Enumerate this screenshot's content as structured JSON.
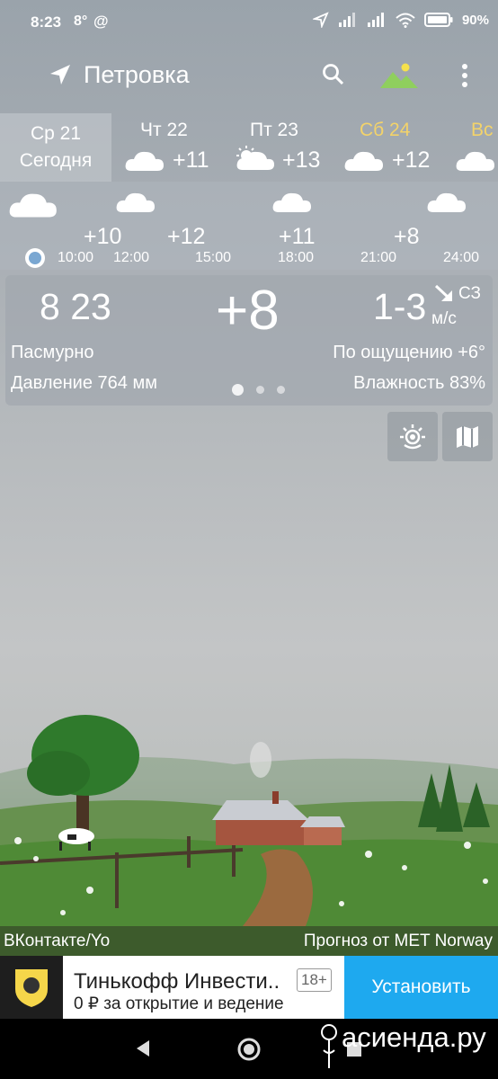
{
  "status": {
    "time": "8:23",
    "temp_notif": "8°",
    "at_icon": "@",
    "battery_percent": "90%"
  },
  "toolbar": {
    "city": "Петровка",
    "icons": [
      "location-arrow-icon",
      "search-icon",
      "landscape-icon",
      "more-vert-icon"
    ]
  },
  "days": [
    {
      "name": "Ср 21",
      "sub": "Сегодня",
      "temp": "",
      "icon": ""
    },
    {
      "name": "Чт 22",
      "temp": "+11",
      "icon": "cloud-icon"
    },
    {
      "name": "Пт 23",
      "temp": "+13",
      "icon": "partly-cloudy-icon"
    },
    {
      "name": "Сб 24",
      "temp": "+12",
      "icon": "cloud-icon"
    },
    {
      "name": "Вс",
      "temp": "",
      "icon": "cloud-icon"
    }
  ],
  "hourly": {
    "temps": [
      "+10",
      "+12",
      "+11",
      "+8"
    ],
    "times": [
      "10:00",
      "12:00",
      "15:00",
      "18:00",
      "21:00",
      "24:00"
    ]
  },
  "current": {
    "time": "8 23",
    "temp": "+8",
    "wind_speed": "1-3",
    "wind_dir": "СЗ",
    "wind_unit": "м/с",
    "condition": "Пасмурно",
    "feels_like": "По ощущению +6°",
    "pressure": "Давление 764 мм",
    "humidity": "Влажность 83%"
  },
  "footer": {
    "left": "ВКонтакте/Yo",
    "right": "Прогноз от MET Norway"
  },
  "ad": {
    "title": "Тинькофф Инвести..",
    "age": "18+",
    "subtitle": "0 ₽ за открытие и ведение",
    "button": "Установить"
  },
  "watermark": "асиенда.ру",
  "colors": {
    "accent_weekend": "#f3d36a",
    "ad_button": "#1ea9ef"
  }
}
